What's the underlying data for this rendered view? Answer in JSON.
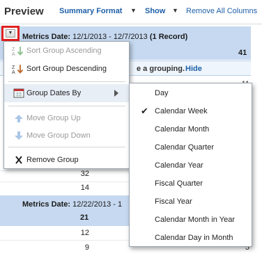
{
  "toolbar": {
    "title": "Preview",
    "summary_format": "Summary Format",
    "show": "Show",
    "remove_all_columns": "Remove All Columns",
    "dropdown_glyph": "▼"
  },
  "table": {
    "group1": {
      "label_prefix": "Metrics Date:",
      "label_range": "12/1/2013 - 12/7/2013",
      "label_count": "(1 Record)",
      "total": "41"
    },
    "hint": {
      "text": "e a grouping.",
      "link": "Hide"
    },
    "right_edge_values": [
      "11",
      "5"
    ],
    "group_rows_values": [
      "32",
      "14"
    ],
    "group2": {
      "label_prefix": "Metrics Date:",
      "label_range": "12/22/2013 - 1",
      "total": "21"
    },
    "group2_rows_values": [
      "12",
      "9"
    ]
  },
  "context_menu": {
    "items": [
      {
        "label": "Sort Group Ascending",
        "disabled": true
      },
      {
        "label": "Sort Group Descending",
        "disabled": false
      },
      {
        "label": "Group Dates By",
        "disabled": false
      },
      {
        "label": "Move Group Up",
        "disabled": true
      },
      {
        "label": "Move Group Down",
        "disabled": true
      },
      {
        "label": "Remove Group",
        "disabled": false
      }
    ]
  },
  "submenu": {
    "selected": "Calendar Week",
    "check_glyph": "✔",
    "items": [
      "Day",
      "Calendar Week",
      "Calendar Month",
      "Calendar Quarter",
      "Calendar Year",
      "Fiscal Quarter",
      "Fiscal Year",
      "Calendar Month in Year",
      "Calendar Day in Month"
    ]
  },
  "colors": {
    "group_header_bg": "#c6d9f0",
    "link": "#1e5fa8",
    "highlight_border": "#e02020"
  }
}
